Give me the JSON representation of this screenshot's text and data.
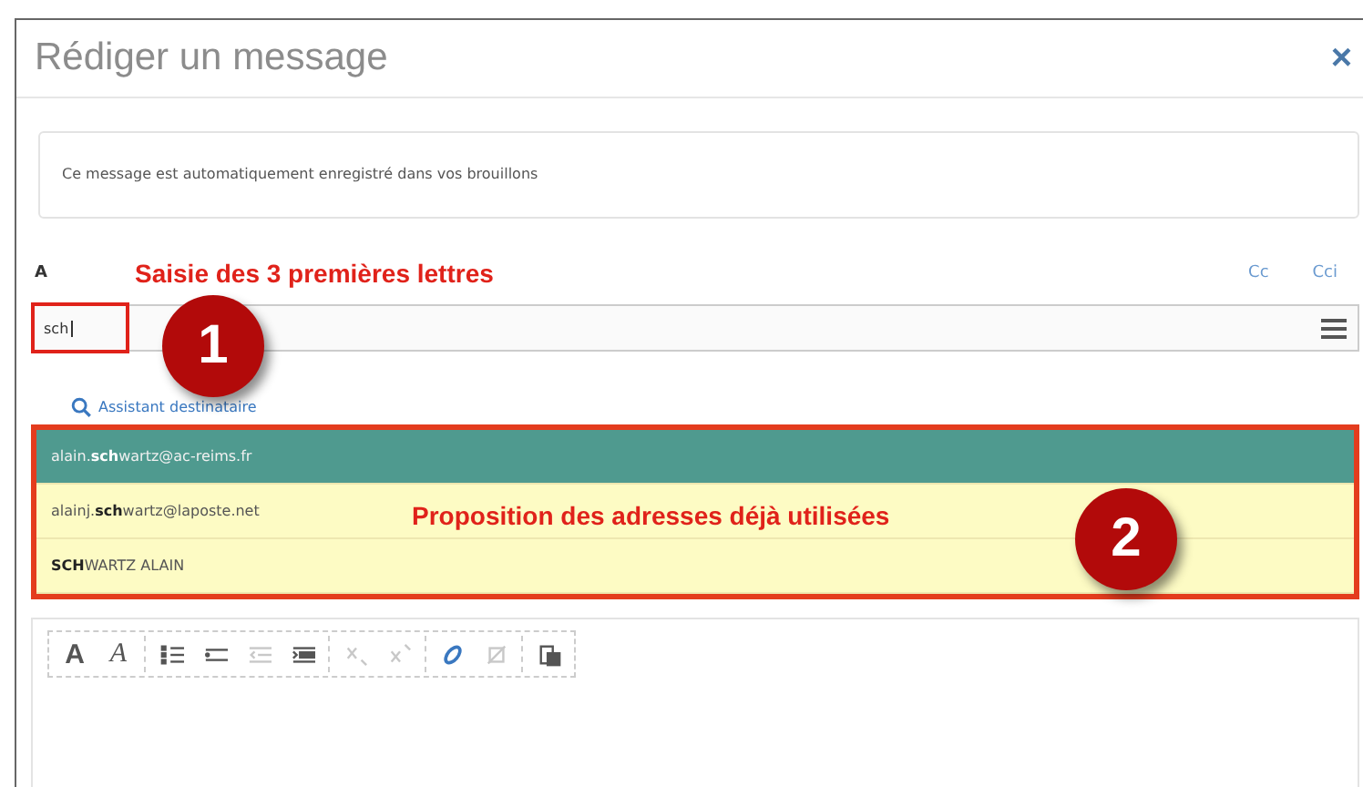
{
  "window": {
    "title": "Rédiger un message",
    "close": "×"
  },
  "notice": "Ce message est automatiquement enregistré dans vos brouillons",
  "recipient": {
    "label": "A",
    "links": [
      "Cc",
      "Cci"
    ],
    "value": "sch",
    "assistant": "Assistant destinataire"
  },
  "suggestions": [
    {
      "text": "alain.**sch**wartz@ac-reims.fr",
      "selected": true
    },
    {
      "text": "alainj.**sch**wartz@laposte.net",
      "selected": false
    },
    {
      "text": "**SCH**WARTZ ALAIN",
      "selected": false
    }
  ],
  "annotations": [
    {
      "number": "1",
      "text": "Saisie des 3 premières lettres"
    },
    {
      "number": "2",
      "text": "Proposition des adresses déjà utilisées"
    }
  ],
  "toolbar": [
    {
      "kind": "bold",
      "label": "A",
      "disabled": false
    },
    {
      "kind": "italic",
      "label": "A",
      "disabled": false
    },
    {
      "kind": "numbered-list",
      "disabled": false
    },
    {
      "kind": "bullet-list",
      "disabled": false
    },
    {
      "kind": "outdent",
      "disabled": true
    },
    {
      "kind": "indent",
      "disabled": false
    },
    {
      "kind": "subscript",
      "disabled": true
    },
    {
      "kind": "superscript",
      "disabled": true
    },
    {
      "kind": "link",
      "disabled": false
    },
    {
      "kind": "unlink",
      "disabled": true
    },
    {
      "kind": "paste",
      "disabled": false
    }
  ]
}
